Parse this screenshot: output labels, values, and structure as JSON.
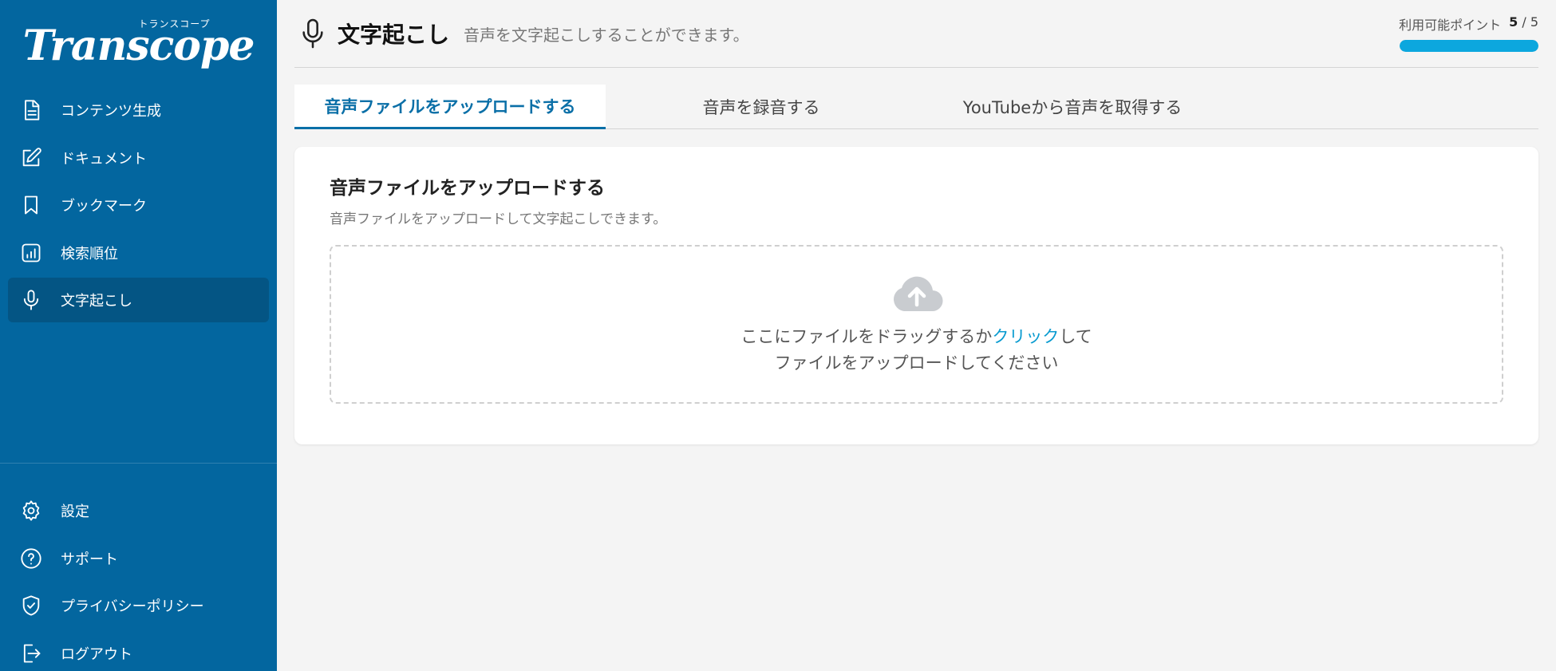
{
  "sidebar": {
    "logo_sub": "トランスコープ",
    "logo_main": "Transcope",
    "items": [
      {
        "label": "コンテンツ生成",
        "icon": "document-icon"
      },
      {
        "label": "ドキュメント",
        "icon": "edit-icon"
      },
      {
        "label": "ブックマーク",
        "icon": "bookmark-icon"
      },
      {
        "label": "検索順位",
        "icon": "bar-chart-icon"
      },
      {
        "label": "文字起こし",
        "icon": "microphone-icon",
        "active": true
      }
    ],
    "bottom_items": [
      {
        "label": "設定",
        "icon": "gear-icon"
      },
      {
        "label": "サポート",
        "icon": "help-icon"
      },
      {
        "label": "プライバシーポリシー",
        "icon": "shield-icon"
      },
      {
        "label": "ログアウト",
        "icon": "logout-icon"
      }
    ]
  },
  "header": {
    "title": "文字起こし",
    "subtitle": "音声を文字起こしすることができます。",
    "points_label": "利用可能ポイント",
    "points_current": "5",
    "points_total": "5",
    "points_fraction": 1.0
  },
  "tabs": [
    {
      "label": "音声ファイルをアップロードする",
      "active": true
    },
    {
      "label": "音声を録音する"
    },
    {
      "label": "YouTubeから音声を取得する"
    }
  ],
  "card": {
    "title": "音声ファイルをアップロードする",
    "description": "音声ファイルをアップロードして文字起こしできます。",
    "drop_text_before": "ここにファイルをドラッグするか",
    "drop_link": "クリック",
    "drop_text_after": "して",
    "drop_text_line2": "ファイルをアップロードしてください"
  },
  "colors": {
    "sidebar_bg": "#03669f",
    "accent": "#0a6fa7",
    "points_bar": "#0ca7de",
    "link": "#0a9bd0"
  }
}
